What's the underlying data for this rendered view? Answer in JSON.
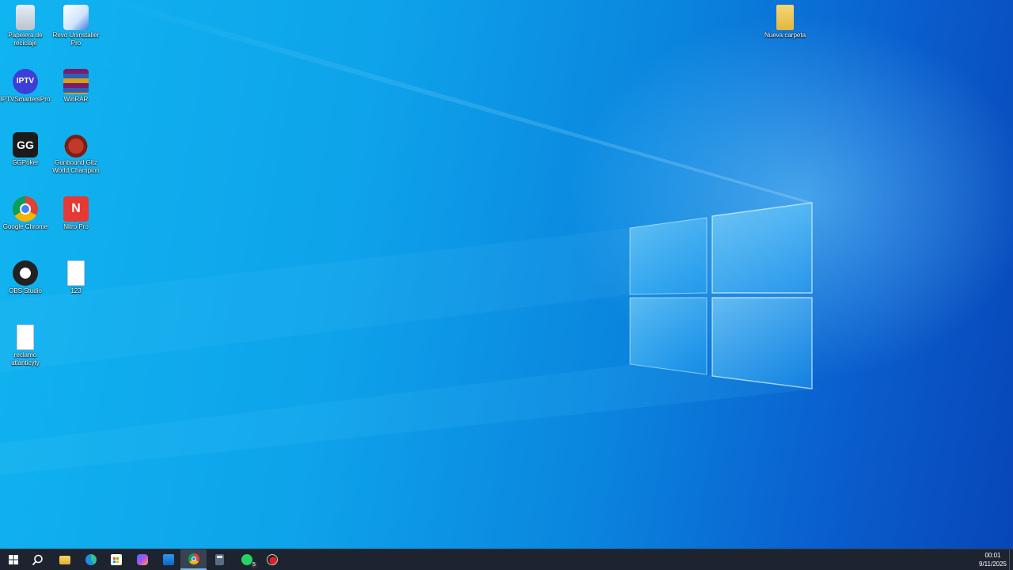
{
  "desktop": {
    "icons": [
      {
        "label": "Papelera de reciclaje",
        "icon": "recycle-bin-icon"
      },
      {
        "label": "Revo Uninstaller Pro",
        "icon": "revo-uninstaller-icon"
      },
      {
        "label": "IPTVSmartersPro",
        "icon": "iptv-icon",
        "glyph": "IPTV"
      },
      {
        "label": "WinRAR",
        "icon": "winrar-icon"
      },
      {
        "label": "GGPoker",
        "icon": "ggpoker-icon",
        "glyph": "GG"
      },
      {
        "label": "Gunbound Gitz World Champion",
        "icon": "gunbound-icon"
      },
      {
        "label": "Google Chrome",
        "icon": "chrome-icon"
      },
      {
        "label": "Nitro Pro",
        "icon": "nitro-pro-icon",
        "glyph": "N"
      },
      {
        "label": "OBS Studio",
        "icon": "obs-studio-icon"
      },
      {
        "label": "123",
        "icon": "text-document-icon"
      },
      {
        "label": "reclamo atlanticyty",
        "icon": "text-document-icon"
      },
      {
        "label": "Nueva carpeta",
        "icon": "folder-icon"
      }
    ]
  },
  "taskbar": {
    "items": [
      {
        "name": "start",
        "icon": "windows-logo-icon"
      },
      {
        "name": "search",
        "icon": "search-icon"
      },
      {
        "name": "file-explorer",
        "icon": "folder-icon"
      },
      {
        "name": "edge",
        "icon": "edge-icon"
      },
      {
        "name": "microsoft-store",
        "icon": "store-icon"
      },
      {
        "name": "copilot",
        "icon": "copilot-icon"
      },
      {
        "name": "outlook",
        "icon": "outlook-icon"
      },
      {
        "name": "chrome",
        "icon": "chrome-icon",
        "active": true
      },
      {
        "name": "calculator",
        "icon": "calculator-icon"
      },
      {
        "name": "whatsapp",
        "icon": "whatsapp-icon",
        "badge": "5"
      },
      {
        "name": "app",
        "icon": "red-circle-app-icon"
      }
    ],
    "clock": {
      "time": "00:01",
      "date": "9/11/2025"
    }
  },
  "colors": {
    "accent": "#76b9ed",
    "taskbar_bg": "#1d2430"
  }
}
